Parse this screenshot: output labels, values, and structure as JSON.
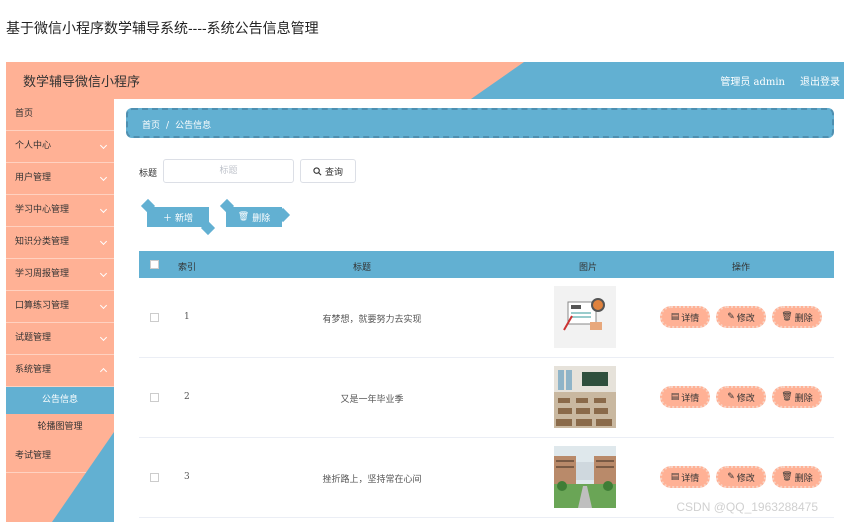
{
  "caption": "基于微信小程序数学辅导系统----系统公告信息管理",
  "header": {
    "app_title": "数学辅导微信小程序",
    "user": "管理员 admin",
    "logout": "退出登录"
  },
  "sidebar": {
    "items": [
      {
        "label": "首页"
      },
      {
        "label": "个人中心"
      },
      {
        "label": "用户管理"
      },
      {
        "label": "学习中心管理"
      },
      {
        "label": "知识分类管理"
      },
      {
        "label": "学习周报管理"
      },
      {
        "label": "口算练习管理"
      },
      {
        "label": "试题管理"
      },
      {
        "label": "系统管理"
      }
    ],
    "sub_items": [
      {
        "label": "公告信息",
        "active": true
      },
      {
        "label": "轮播图管理",
        "active": false
      }
    ],
    "last_item": {
      "label": "考试管理"
    }
  },
  "breadcrumb": {
    "home": "首页",
    "sep": "/",
    "current": "公告信息"
  },
  "search": {
    "label": "标题",
    "placeholder": "标题",
    "button": "查询"
  },
  "actions": {
    "add": "新增",
    "delete": "删除"
  },
  "table": {
    "headers": {
      "index": "索引",
      "title": "标题",
      "image": "图片",
      "ops": "操作"
    },
    "rows": [
      {
        "index": "1",
        "title": "有梦想，就要努力去实现",
        "image": "news-illustration"
      },
      {
        "index": "2",
        "title": "又是一年毕业季",
        "image": "classroom-photo"
      },
      {
        "index": "3",
        "title": "挫折路上，坚持常在心间",
        "image": "campus-photo"
      }
    ],
    "row_buttons": {
      "detail": "详情",
      "edit": "修改",
      "delete": "删除"
    }
  },
  "watermark": "CSDN @QQ_1963288475",
  "colors": {
    "salmon": "#ffb195",
    "blue": "#62b0d2"
  }
}
